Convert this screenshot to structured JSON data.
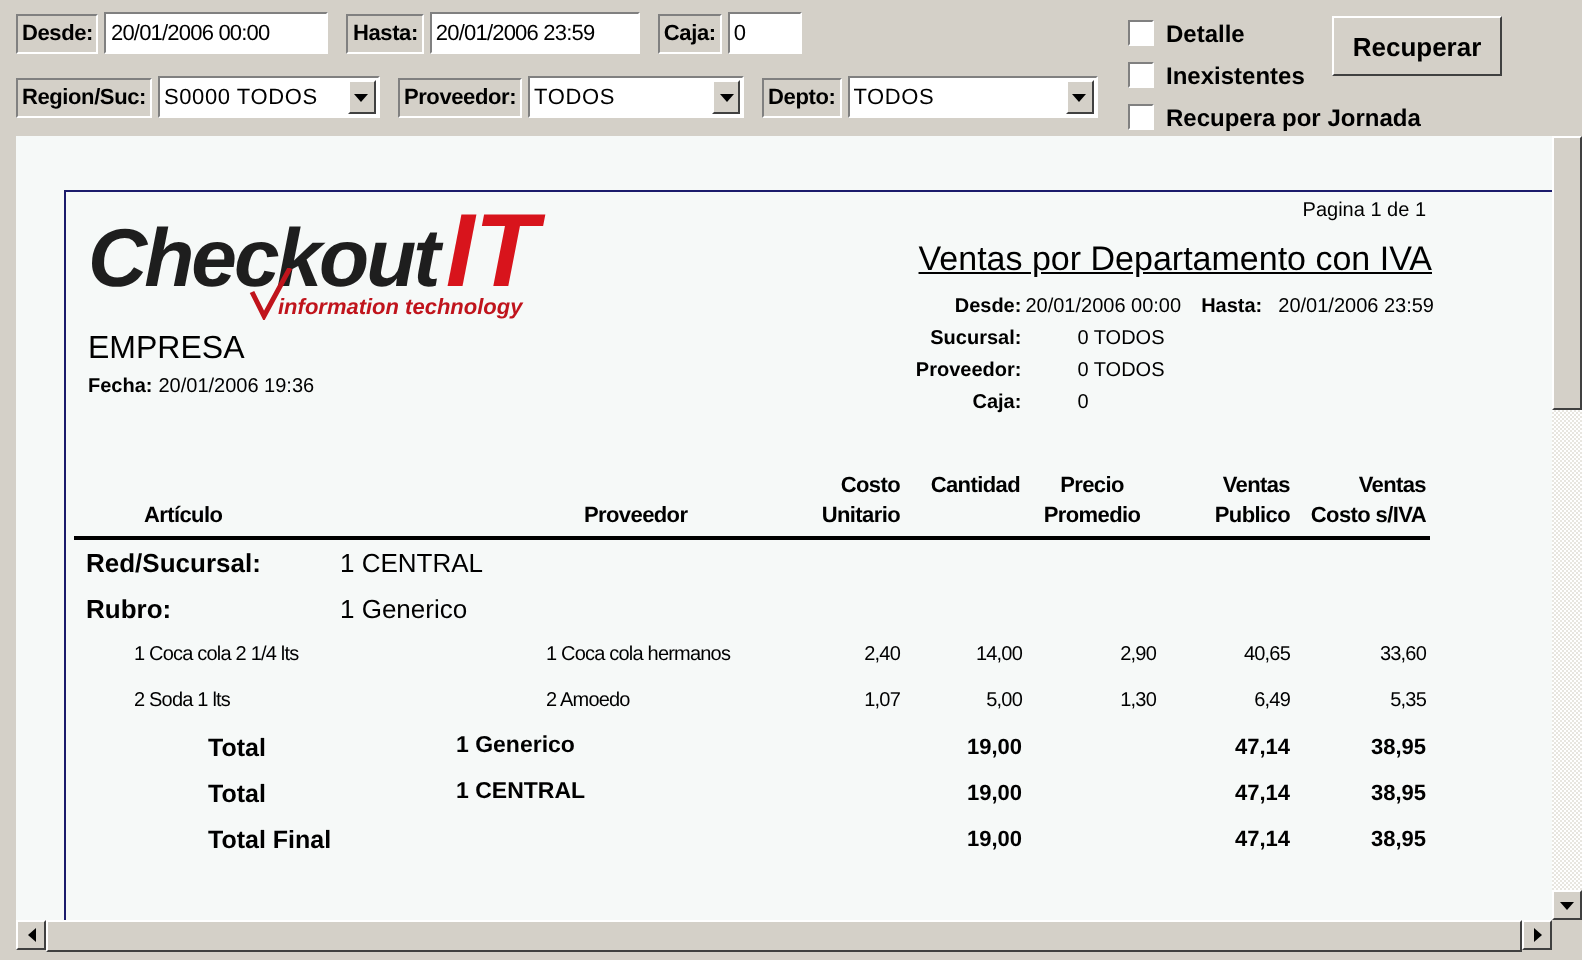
{
  "filters": {
    "fields": [
      {
        "label": "Desde:",
        "value": "20/01/2006 00:00",
        "kind": "text"
      },
      {
        "label": "Hasta:",
        "value": "20/01/2006 23:59",
        "kind": "text"
      },
      {
        "label": "Caja:",
        "value": "0",
        "kind": "text"
      }
    ],
    "selects": [
      {
        "label": "Region/Suc:",
        "value": "S0000 TODOS",
        "kind": "select"
      },
      {
        "label": "Proveedor:",
        "value": "TODOS",
        "kind": "select"
      },
      {
        "label": "Depto:",
        "value": "TODOS",
        "kind": "select"
      }
    ],
    "checkboxes": [
      {
        "label": "Detalle",
        "checked": false
      },
      {
        "label": "Inexistentes",
        "checked": false
      },
      {
        "label": "Recupera por Jornada",
        "checked": false
      }
    ],
    "button": "Recuperar"
  },
  "report": {
    "logo": {
      "main": "Checkout",
      "accent": "IT",
      "tagline": "information technology"
    },
    "company": "EMPRESA",
    "date_label": "Fecha:",
    "date_value": "20/01/2006 19:36",
    "page": "Pagina 1 de 1",
    "title": "Ventas por Departamento con IVA",
    "params": [
      {
        "label": "Desde:",
        "value": "20/01/2006 00:00",
        "extra_label": "Hasta:",
        "extra_value": "20/01/2006 23:59"
      },
      {
        "label": "Sucursal:",
        "value": "0 TODOS"
      },
      {
        "label": "Proveedor:",
        "value": "0 TODOS"
      },
      {
        "label": "Caja:",
        "value": "0"
      }
    ],
    "columns": [
      [
        "Artículo"
      ],
      [
        "Proveedor"
      ],
      [
        "Costo",
        "Unitario"
      ],
      [
        "Cantidad"
      ],
      [
        "Precio",
        "Promedio"
      ],
      [
        "Ventas",
        "Publico"
      ],
      [
        "Ventas",
        "Costo s/IVA"
      ]
    ],
    "rows": [
      {
        "kind": "group",
        "label": "Red/Sucursal:",
        "value": "1  CENTRAL"
      },
      {
        "kind": "group",
        "label": "Rubro:",
        "value": "1  Generico"
      },
      {
        "kind": "item",
        "cells": [
          "1 Coca cola 2 1/4 lts",
          "1 Coca cola hermanos",
          "2,40",
          "14,00",
          "2,90",
          "40,65",
          "33,60"
        ]
      },
      {
        "kind": "item",
        "cells": [
          "2 Soda 1 lts",
          "2 Amoedo",
          "1,07",
          "5,00",
          "1,30",
          "6,49",
          "5,35"
        ]
      },
      {
        "kind": "total",
        "label": "Total",
        "value": "1 Generico",
        "cells": [
          "19,00",
          "47,14",
          "38,95"
        ]
      },
      {
        "kind": "total",
        "label": "Total",
        "value": "1 CENTRAL",
        "cells": [
          "19,00",
          "47,14",
          "38,95"
        ]
      },
      {
        "kind": "total",
        "label": "Total Final",
        "cells": [
          "19,00",
          "47,14",
          "38,95"
        ]
      }
    ]
  }
}
